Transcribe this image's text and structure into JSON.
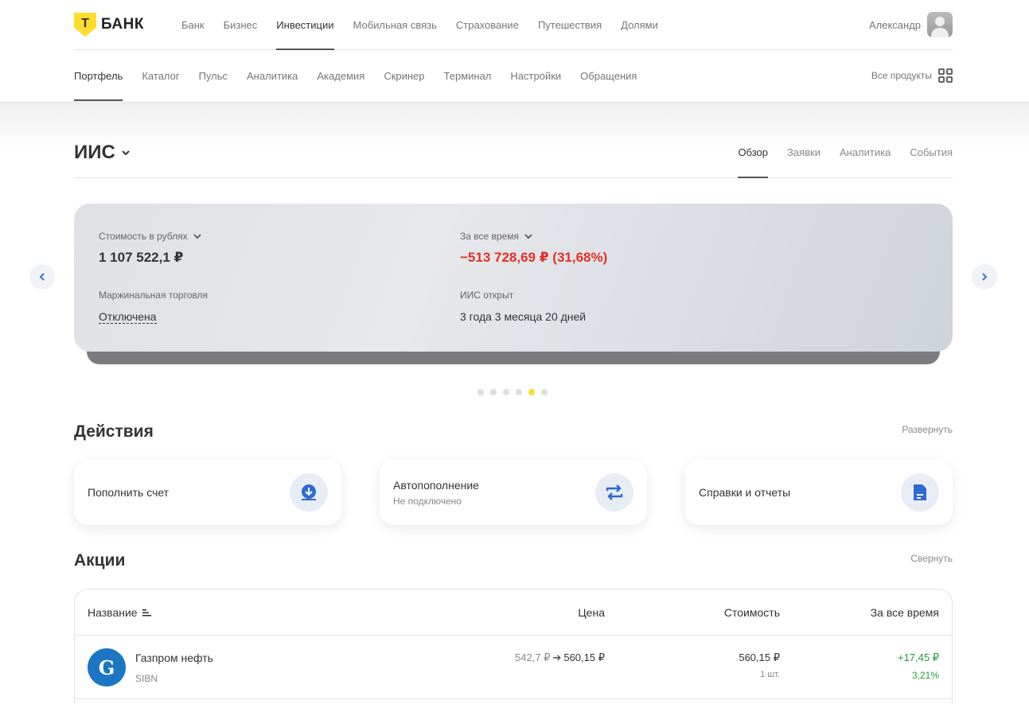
{
  "brand": {
    "logo_letter": "Т",
    "name": "БАНК"
  },
  "topnav": {
    "items": [
      "Банк",
      "Бизнес",
      "Инвестиции",
      "Мобильная связь",
      "Страхование",
      "Путешествия",
      "Долями"
    ],
    "active": "Инвестиции",
    "user_name": "Александр"
  },
  "subnav": {
    "items": [
      "Портфель",
      "Каталог",
      "Пульс",
      "Аналитика",
      "Академия",
      "Скринер",
      "Терминал",
      "Настройки",
      "Обращения"
    ],
    "active": "Портфель",
    "all_products": "Все продукты"
  },
  "account": {
    "title": "ИИС",
    "tabs": [
      "Обзор",
      "Заявки",
      "Аналитика",
      "События"
    ],
    "active_tab": "Обзор"
  },
  "summary": {
    "value_label": "Стоимость в рублях",
    "value": "1 107 522,1 ₽",
    "alltime_label": "За все время",
    "alltime": "−513 728,69 ₽ (31,68%)",
    "margin_label": "Маржинальная торговля",
    "margin_value": "Отключена",
    "opened_label": "ИИС открыт",
    "opened_value": "3 года 3 месяца 20 дней",
    "slides_count": 6,
    "active_slide": 5
  },
  "actions": {
    "title": "Действия",
    "expand": "Развернуть",
    "items": [
      {
        "label": "Пополнить счет",
        "sub": "",
        "icon": "download-icon"
      },
      {
        "label": "Автопополнение",
        "sub": "Не подключено",
        "icon": "repeat-icon"
      },
      {
        "label": "Справки и отчеты",
        "sub": "",
        "icon": "document-icon"
      }
    ]
  },
  "stocks": {
    "title": "Акции",
    "collapse": "Свернуть",
    "columns": {
      "name": "Название",
      "price": "Цена",
      "value": "Стоимость",
      "alltime": "За все время"
    },
    "rows": [
      {
        "name": "Газпром нефть",
        "ticker": "SIBN",
        "price_from": "542,7 ₽",
        "price_to": "560,15 ₽",
        "value": "560,15 ₽",
        "qty": "1 шт.",
        "gain": "+17,45 ₽",
        "gain_pct": "3,21%"
      }
    ]
  },
  "colors": {
    "accent": "#ffdd2d",
    "negative": "#e0312b",
    "positive": "#1f9e3a",
    "link_blue": "#3b73d8"
  }
}
